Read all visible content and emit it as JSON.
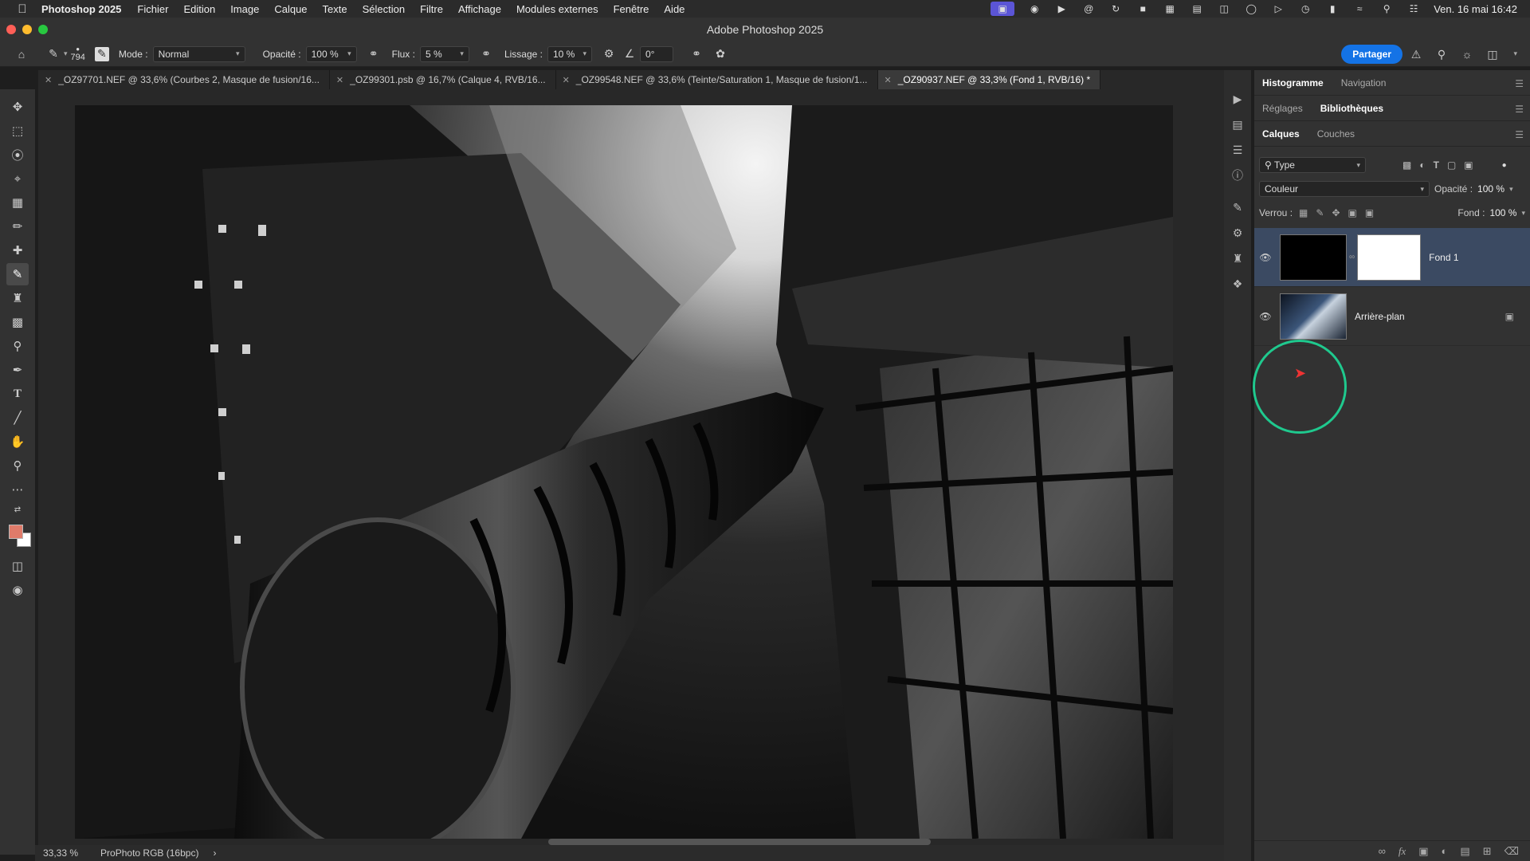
{
  "menubar": {
    "app_name": "Photoshop 2025",
    "items": [
      "Fichier",
      "Edition",
      "Image",
      "Calque",
      "Texte",
      "Sélection",
      "Filtre",
      "Affichage",
      "Modules externes",
      "Fenêtre",
      "Aide"
    ],
    "datetime": "Ven. 16 mai  16:42"
  },
  "window": {
    "title": "Adobe Photoshop 2025"
  },
  "options": {
    "brush_size": "794",
    "mode_label": "Mode :",
    "mode_value": "Normal",
    "opacity_label": "Opacité :",
    "opacity_value": "100 %",
    "flux_label": "Flux :",
    "flux_value": "5 %",
    "lissage_label": "Lissage :",
    "lissage_value": "10 %",
    "angle_value": "0°",
    "share_label": "Partager"
  },
  "tabs": [
    {
      "label": "_OZ97701.NEF @ 33,6% (Courbes 2, Masque de fusion/16..."
    },
    {
      "label": "_OZ99301.psb @ 16,7% (Calque 4, RVB/16..."
    },
    {
      "label": "_OZ99548.NEF @ 33,6% (Teinte/Saturation 1, Masque de fusion/1..."
    },
    {
      "label": "_OZ90937.NEF @ 33,3% (Fond 1, RVB/16) *"
    }
  ],
  "status": {
    "zoom": "33,33 %",
    "profile": "ProPhoto RGB (16bpc)",
    "arrow": "›"
  },
  "panels": {
    "top_tabs": [
      "Histogramme",
      "Navigation"
    ],
    "mid_tabs": [
      "Réglages",
      "Bibliothèques"
    ],
    "layer_tabs": [
      "Calques",
      "Couches"
    ],
    "filter_value": "Type",
    "blend_value": "Couleur",
    "opacity_label": "Opacité :",
    "opacity_value": "100 %",
    "lock_label": "Verrou :",
    "fill_label": "Fond :",
    "fill_value": "100 %"
  },
  "layers": [
    {
      "name": "Fond 1",
      "selected": true
    },
    {
      "name": "Arrière-plan",
      "selected": false
    }
  ],
  "colors": {
    "foreground": "#e07b6a",
    "background": "#ffffff",
    "accent": "#1473e6",
    "cursor_ring": "#1fc98e",
    "selected_layer": "#3b4a62"
  }
}
